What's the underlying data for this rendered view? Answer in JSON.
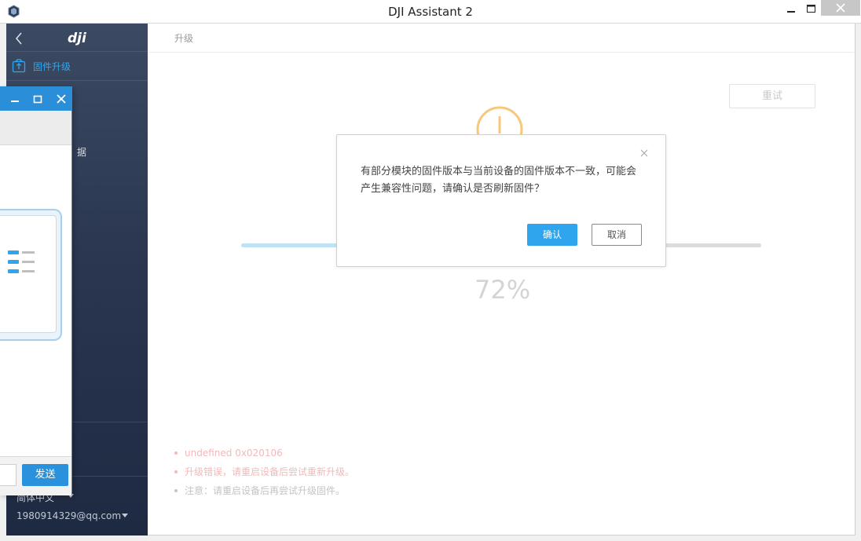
{
  "window": {
    "title": "DJI Assistant 2",
    "app_icon": "dji-assistant-app-icon"
  },
  "sidebar": {
    "logo": "dji",
    "back_icon": "chevron-left-icon",
    "active_item": {
      "label": "固件升级",
      "icon": "firmware-box-icon"
    },
    "partial_item_fragment": "据",
    "language": "简体中文",
    "account": "1980914329@qq.com"
  },
  "main": {
    "breadcrumb": "升级",
    "retry_label": "重试",
    "progress": {
      "percent_text": "72%",
      "fraction": 0.72
    },
    "logs": [
      {
        "text": "undefined 0x020106",
        "type": "error"
      },
      {
        "text": "升级错误，请重启设备后尝试重新升级。",
        "type": "error"
      },
      {
        "text": "注意：请重启设备后再尝试升级固件。",
        "type": "note"
      }
    ]
  },
  "modal": {
    "message": "有部分模块的固件版本与当前设备的固件版本不一致，可能会产生兼容性问题，请确认是否刷新固件？",
    "confirm_label": "确认",
    "cancel_label": "取消"
  },
  "overlay_window": {
    "send_label": "发送"
  },
  "colors": {
    "accent": "#2ea5ec",
    "sidebar_top": "#3b4a62",
    "sidebar_bottom": "#1e2a42",
    "warning": "#f7c77a",
    "error_text": "#f2b9b9",
    "overlay_title": "#2a8fd8"
  }
}
